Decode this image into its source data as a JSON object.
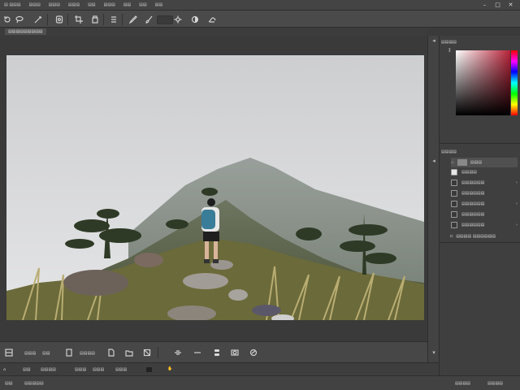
{
  "menu": {
    "items": [
      "▤ ▤▤▤",
      "▤▤▤",
      "▤▤▤",
      "▤▤▤",
      "▤▤",
      "▤▤▤",
      "▤▤",
      "▤▤",
      "▤▤"
    ],
    "window_controls": [
      "minimize-icon",
      "maximize-icon",
      "close-icon"
    ]
  },
  "document": {
    "tab_label": "▤▤▤▤▤▤▤▤▤"
  },
  "panels": {
    "color_title": "▤▤▤▤",
    "layers_title": "▤▤▤▤",
    "layers": [
      {
        "label": "▤▤▤",
        "active": true
      },
      {
        "label": "▤▤▤▤",
        "active": false
      },
      {
        "label": "▤▤▤▤▤▤",
        "active": false
      },
      {
        "label": "▤▤▤▤▤▤",
        "active": false
      },
      {
        "label": "▤▤▤▤▤▤",
        "active": false
      },
      {
        "label": "▤▤▤▤▤▤",
        "active": false
      },
      {
        "label": "▤▤▤▤▤▤",
        "active": false
      }
    ],
    "layers_footer": "▤▤▤▤ ▤▤▤▤▤▤"
  },
  "bottom": {
    "labels": [
      "▤▤▤",
      "▤▤",
      "▤▤▤▤"
    ],
    "labels2": [
      "▤▤",
      "▤▤▤▤",
      "▤▤▤",
      "▤▤▤",
      "▤▤▤"
    ]
  },
  "status": {
    "items": [
      "▤▤",
      "▤▤▤▤▤",
      "▤▤▤▤",
      "▤▤▤▤"
    ]
  },
  "colors": {
    "ui_bg": "#3a3a3a",
    "panel_bg": "#3f3f3f",
    "toolbar_bg": "#4a4a4a",
    "accent_red": "#b8243a"
  }
}
